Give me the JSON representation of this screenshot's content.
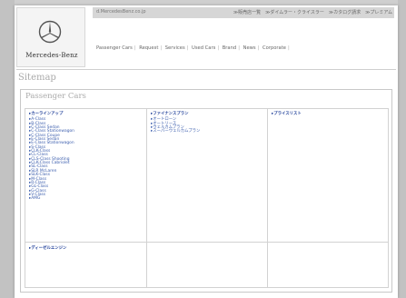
{
  "header": {
    "brand_name": "Mercedes-Benz",
    "domain": "d.MercedesBenz.co.jp",
    "utility_links": [
      "≫販売店一覧",
      "≫ダイムラー・クライスラー",
      "≫カタログ請求",
      "≫プレミアム"
    ],
    "nav_items": [
      "Passenger Cars",
      "Request",
      "Services",
      "Used Cars",
      "Brand",
      "News",
      "Corporate"
    ]
  },
  "page_title": "Sitemap",
  "section_title": "Passenger Cars",
  "columns": [
    {
      "heading": "▸カーラインアップ",
      "items": [
        "▸A-Class",
        "▸B-Class",
        "▸C-Class Sedan",
        "▸C-Class Stationwagon",
        "▸C-Class Coupe",
        "▸E-Class Sedan",
        "▸E-Class Stationwagon",
        "▸S-Class",
        "▸CLK-Class",
        "▸CL-Class",
        "▸CLS-Class Shooting",
        "▸CLK-Class Cabriolet",
        "▸SL-Class",
        "▸SLR McLaren",
        "▸SLK-Class",
        "▸M-Class",
        "▸R-Class",
        "▸GL-Class",
        "▸G-Class",
        "▸V-Class",
        "▸AMG"
      ]
    },
    {
      "heading": "▸ファイナンスプラン",
      "items": [
        "▸オートローン",
        "▸オートリース",
        "▸ウェルカムプラン",
        "▸スーパーウェルカムプラン"
      ]
    },
    {
      "heading": "▸プライスリスト",
      "items": []
    },
    {
      "heading": "▸ディーゼルエンジン",
      "items": []
    }
  ]
}
